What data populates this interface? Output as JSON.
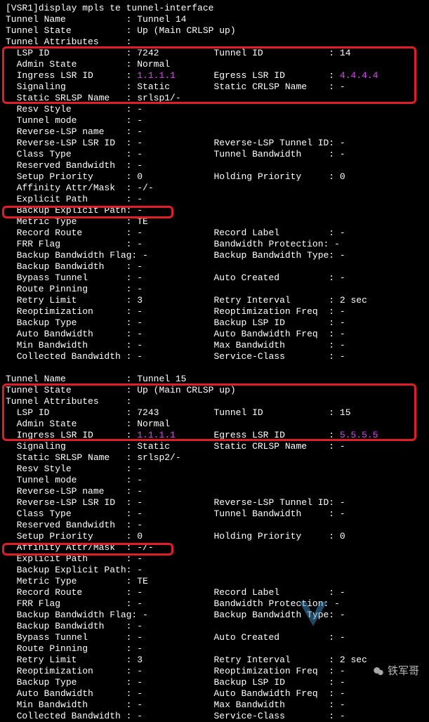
{
  "prompt": "[VSR1]display mpls te tunnel-interface",
  "tunnels": [
    {
      "header": [
        {
          "l": "Tunnel Name",
          "v": "Tunnel 14"
        },
        {
          "l": "Tunnel State",
          "v": "Up (Main CRLSP up)"
        },
        {
          "l": "Tunnel Attributes",
          "v": ""
        }
      ],
      "box1": [
        {
          "l": "LSP ID",
          "v": "7242",
          "l2": "Tunnel ID",
          "v2": "14"
        },
        {
          "l": "Admin State",
          "v": "Normal"
        },
        {
          "l": "Ingress LSR ID",
          "v": "1.1.1.1",
          "vClass": "magenta",
          "l2": "Egress LSR ID",
          "v2": "4.4.4.4",
          "v2Class": "magenta"
        },
        {
          "l": "Signaling",
          "v": "Static",
          "l2": "Static CRLSP Name",
          "v2": "-"
        },
        {
          "l": "Static SRLSP Name",
          "v": "srlsp1/-"
        }
      ],
      "body1": [
        {
          "l": "Resv Style",
          "v": "-"
        },
        {
          "l": "Tunnel mode",
          "v": "-"
        },
        {
          "l": "Reverse-LSP name",
          "v": "-"
        },
        {
          "l": "Reverse-LSP LSR ID",
          "v": "-",
          "l2": "Reverse-LSP Tunnel ID",
          "v2": "-",
          "tight": true
        },
        {
          "l": "Class Type",
          "v": "-",
          "l2": "Tunnel Bandwidth",
          "v2": "-"
        },
        {
          "l": "Reserved Bandwidth",
          "v": "-"
        },
        {
          "l": "Setup Priority",
          "v": "0",
          "l2": "Holding Priority",
          "v2": "0"
        },
        {
          "l": "Affinity Attr/Mask",
          "v": "-/-"
        },
        {
          "l": "Explicit Path",
          "v": "-"
        },
        {
          "l": "Backup Explicit Path",
          "v": "-",
          "tight": true
        }
      ],
      "box2": [
        {
          "l": "Metric Type",
          "v": "TE"
        }
      ],
      "body2": [
        {
          "l": "Record Route",
          "v": "-",
          "l2": "Record Label",
          "v2": "-"
        },
        {
          "l": "FRR Flag",
          "v": "-",
          "l2": "Bandwidth Protection",
          "v2": "-",
          "tight": true
        },
        {
          "l": "Backup Bandwidth Flag",
          "v": "-",
          "l2": "Backup Bandwidth Type",
          "v2": "-",
          "tight": true,
          "tightL": true
        },
        {
          "l": "Backup Bandwidth",
          "v": "-"
        },
        {
          "l": "Bypass Tunnel",
          "v": "-",
          "l2": "Auto Created",
          "v2": "-"
        },
        {
          "l": "Route Pinning",
          "v": "-"
        },
        {
          "l": "Retry Limit",
          "v": "3",
          "l2": "Retry Interval",
          "v2": "2 sec"
        },
        {
          "l": "Reoptimization",
          "v": "-",
          "l2": "Reoptimization Freq",
          "v2": "-"
        },
        {
          "l": "Backup Type",
          "v": "-",
          "l2": "Backup LSP ID",
          "v2": "-"
        },
        {
          "l": "Auto Bandwidth",
          "v": "-",
          "l2": "Auto Bandwidth Freq",
          "v2": "-"
        },
        {
          "l": "Min Bandwidth",
          "v": "-",
          "l2": "Max Bandwidth",
          "v2": "-"
        },
        {
          "l": "Collected Bandwidth",
          "v": "-",
          "l2": "Service-Class",
          "v2": "-"
        }
      ]
    },
    {
      "header": [
        {
          "l": "Tunnel Name",
          "v": "Tunnel 15"
        },
        {
          "l": "Tunnel State",
          "v": "Up (Main CRLSP up)"
        },
        {
          "l": "Tunnel Attributes",
          "v": ""
        }
      ],
      "box1": [
        {
          "l": "LSP ID",
          "v": "7243",
          "l2": "Tunnel ID",
          "v2": "15"
        },
        {
          "l": "Admin State",
          "v": "Normal"
        },
        {
          "l": "Ingress LSR ID",
          "v": "1.1.1.1",
          "vClass": "magenta",
          "l2": "Egress LSR ID",
          "v2": "5.5.5.5",
          "v2Class": "magenta"
        },
        {
          "l": "Signaling",
          "v": "Static",
          "l2": "Static CRLSP Name",
          "v2": "-"
        },
        {
          "l": "Static SRLSP Name",
          "v": "srlsp2/-"
        }
      ],
      "body1": [
        {
          "l": "Resv Style",
          "v": "-"
        },
        {
          "l": "Tunnel mode",
          "v": "-"
        },
        {
          "l": "Reverse-LSP name",
          "v": "-"
        },
        {
          "l": "Reverse-LSP LSR ID",
          "v": "-",
          "l2": "Reverse-LSP Tunnel ID",
          "v2": "-",
          "tight": true
        },
        {
          "l": "Class Type",
          "v": "-",
          "l2": "Tunnel Bandwidth",
          "v2": "-"
        },
        {
          "l": "Reserved Bandwidth",
          "v": "-"
        },
        {
          "l": "Setup Priority",
          "v": "0",
          "l2": "Holding Priority",
          "v2": "0"
        },
        {
          "l": "Affinity Attr/Mask",
          "v": "-/-"
        },
        {
          "l": "Explicit Path",
          "v": "-"
        },
        {
          "l": "Backup Explicit Path",
          "v": "-",
          "tight": true
        }
      ],
      "box2": [
        {
          "l": "Metric Type",
          "v": "TE"
        }
      ],
      "body2": [
        {
          "l": "Record Route",
          "v": "-",
          "l2": "Record Label",
          "v2": "-"
        },
        {
          "l": "FRR Flag",
          "v": "-",
          "l2": "Bandwidth Protection",
          "v2": "-",
          "tight": true
        },
        {
          "l": "Backup Bandwidth Flag",
          "v": "-",
          "l2": "Backup Bandwidth Type",
          "v2": "-",
          "tight": true,
          "tightL": true
        },
        {
          "l": "Backup Bandwidth",
          "v": "-"
        },
        {
          "l": "Bypass Tunnel",
          "v": "-",
          "l2": "Auto Created",
          "v2": "-"
        },
        {
          "l": "Route Pinning",
          "v": "-"
        },
        {
          "l": "Retry Limit",
          "v": "3",
          "l2": "Retry Interval",
          "v2": "2 sec"
        },
        {
          "l": "Reoptimization",
          "v": "-",
          "l2": "Reoptimization Freq",
          "v2": "-"
        },
        {
          "l": "Backup Type",
          "v": "-",
          "l2": "Backup LSP ID",
          "v2": "-"
        },
        {
          "l": "Auto Bandwidth",
          "v": "-",
          "l2": "Auto Bandwidth Freq",
          "v2": "-"
        },
        {
          "l": "Min Bandwidth",
          "v": "-",
          "l2": "Max Bandwidth",
          "v2": "-"
        },
        {
          "l": "Collected Bandwidth",
          "v": "-",
          "l2": "Service-Class",
          "v2": "-"
        }
      ]
    }
  ],
  "watermark_text": "铁军哥"
}
